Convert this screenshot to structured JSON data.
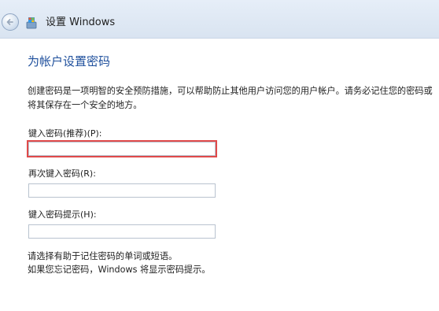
{
  "window": {
    "title": "设置 Windows",
    "back_icon": "back-arrow-icon",
    "app_icon": "windows-setup-icon"
  },
  "page": {
    "heading": "为帐户设置密码",
    "description": "创建密码是一项明智的安全预防措施，可以帮助防止其他用户访问您的用户帐户。请务必记住您的密码或将其保存在一个安全的地方。"
  },
  "fields": {
    "password": {
      "label": "键入密码(推荐)(P):",
      "value": "",
      "placeholder": ""
    },
    "confirm": {
      "label": "再次键入密码(R):",
      "value": "",
      "placeholder": ""
    },
    "hint": {
      "label": "键入密码提示(H):",
      "value": "",
      "placeholder": ""
    }
  },
  "hint_note": {
    "line1": "请选择有助于记住密码的单词或短语。",
    "line2": "如果您忘记密码，Windows 将显示密码提示。"
  },
  "colors": {
    "heading": "#1e4f9c",
    "highlight": "#e04a4a",
    "titlebar": "#dde7f3"
  }
}
